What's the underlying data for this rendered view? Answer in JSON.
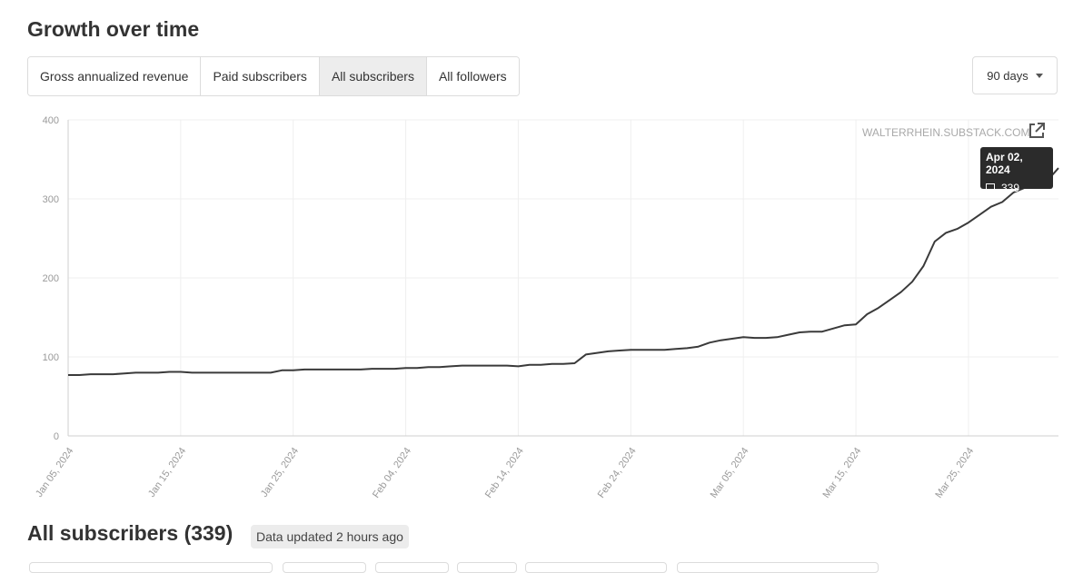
{
  "page": {
    "title": "Growth over time",
    "tabs": [
      {
        "label": "Gross annualized revenue",
        "active": false
      },
      {
        "label": "Paid subscribers",
        "active": false
      },
      {
        "label": "All subscribers",
        "active": true
      },
      {
        "label": "All followers",
        "active": false
      }
    ],
    "range_select": {
      "value": "90 days",
      "icon": "chevron-down-icon"
    },
    "watermark": "WALTERRHEIN.SUBSTACK.COM",
    "external_icon": "external-link-icon",
    "tooltip": {
      "date": "Apr 02, 2024",
      "value": "339"
    },
    "subscribers_heading": "All subscribers (339)",
    "updated_badge": "Data updated 2 hours ago"
  },
  "colors": {
    "line": "#3a3a3a",
    "grid": "#efefef",
    "tick_text": "#9a9a9a",
    "tab_active_bg": "#ededed",
    "tooltip_bg": "#2b2b2b"
  },
  "chart_data": {
    "type": "line",
    "y_ticks": [
      "0",
      "100",
      "200",
      "300",
      "400"
    ],
    "ylim": [
      0,
      400
    ],
    "x_tick_labels": [
      "Jan 05, 2024",
      "Jan 15, 2024",
      "Jan 25, 2024",
      "Feb 04, 2024",
      "Feb 14, 2024",
      "Feb 24, 2024",
      "Mar 05, 2024",
      "Mar 15, 2024",
      "Mar 25, 2024"
    ],
    "x_range": [
      "2024-01-05",
      "2024-04-02"
    ],
    "grid": true,
    "series": [
      {
        "points": [
          [
            "2024-01-05",
            77
          ],
          [
            "2024-01-06",
            77
          ],
          [
            "2024-01-07",
            78
          ],
          [
            "2024-01-08",
            78
          ],
          [
            "2024-01-09",
            78
          ],
          [
            "2024-01-10",
            79
          ],
          [
            "2024-01-11",
            80
          ],
          [
            "2024-01-12",
            80
          ],
          [
            "2024-01-13",
            80
          ],
          [
            "2024-01-14",
            81
          ],
          [
            "2024-01-15",
            81
          ],
          [
            "2024-01-16",
            80
          ],
          [
            "2024-01-17",
            80
          ],
          [
            "2024-01-18",
            80
          ],
          [
            "2024-01-19",
            80
          ],
          [
            "2024-01-20",
            80
          ],
          [
            "2024-01-21",
            80
          ],
          [
            "2024-01-22",
            80
          ],
          [
            "2024-01-23",
            80
          ],
          [
            "2024-01-24",
            83
          ],
          [
            "2024-01-25",
            83
          ],
          [
            "2024-01-26",
            84
          ],
          [
            "2024-01-27",
            84
          ],
          [
            "2024-01-28",
            84
          ],
          [
            "2024-01-29",
            84
          ],
          [
            "2024-01-30",
            84
          ],
          [
            "2024-01-31",
            84
          ],
          [
            "2024-02-01",
            85
          ],
          [
            "2024-02-02",
            85
          ],
          [
            "2024-02-03",
            85
          ],
          [
            "2024-02-04",
            86
          ],
          [
            "2024-02-05",
            86
          ],
          [
            "2024-02-06",
            87
          ],
          [
            "2024-02-07",
            87
          ],
          [
            "2024-02-08",
            88
          ],
          [
            "2024-02-09",
            89
          ],
          [
            "2024-02-10",
            89
          ],
          [
            "2024-02-11",
            89
          ],
          [
            "2024-02-12",
            89
          ],
          [
            "2024-02-13",
            89
          ],
          [
            "2024-02-14",
            88
          ],
          [
            "2024-02-15",
            90
          ],
          [
            "2024-02-16",
            90
          ],
          [
            "2024-02-17",
            91
          ],
          [
            "2024-02-18",
            91
          ],
          [
            "2024-02-19",
            92
          ],
          [
            "2024-02-20",
            103
          ],
          [
            "2024-02-21",
            105
          ],
          [
            "2024-02-22",
            107
          ],
          [
            "2024-02-23",
            108
          ],
          [
            "2024-02-24",
            109
          ],
          [
            "2024-02-25",
            109
          ],
          [
            "2024-02-26",
            109
          ],
          [
            "2024-02-27",
            109
          ],
          [
            "2024-02-28",
            110
          ],
          [
            "2024-02-29",
            111
          ],
          [
            "2024-03-01",
            113
          ],
          [
            "2024-03-02",
            118
          ],
          [
            "2024-03-03",
            121
          ],
          [
            "2024-03-04",
            123
          ],
          [
            "2024-03-05",
            125
          ],
          [
            "2024-03-06",
            124
          ],
          [
            "2024-03-07",
            124
          ],
          [
            "2024-03-08",
            125
          ],
          [
            "2024-03-09",
            128
          ],
          [
            "2024-03-10",
            131
          ],
          [
            "2024-03-11",
            132
          ],
          [
            "2024-03-12",
            132
          ],
          [
            "2024-03-13",
            136
          ],
          [
            "2024-03-14",
            140
          ],
          [
            "2024-03-15",
            141
          ],
          [
            "2024-03-16",
            154
          ],
          [
            "2024-03-17",
            162
          ],
          [
            "2024-03-18",
            172
          ],
          [
            "2024-03-19",
            182
          ],
          [
            "2024-03-20",
            195
          ],
          [
            "2024-03-21",
            215
          ],
          [
            "2024-03-22",
            246
          ],
          [
            "2024-03-23",
            257
          ],
          [
            "2024-03-24",
            262
          ],
          [
            "2024-03-25",
            270
          ],
          [
            "2024-03-26",
            280
          ],
          [
            "2024-03-27",
            290
          ],
          [
            "2024-03-28",
            296
          ],
          [
            "2024-03-29",
            308
          ],
          [
            "2024-03-30",
            314
          ],
          [
            "2024-03-31",
            318
          ],
          [
            "2024-04-01",
            323
          ],
          [
            "2024-04-02",
            339
          ]
        ]
      }
    ]
  }
}
